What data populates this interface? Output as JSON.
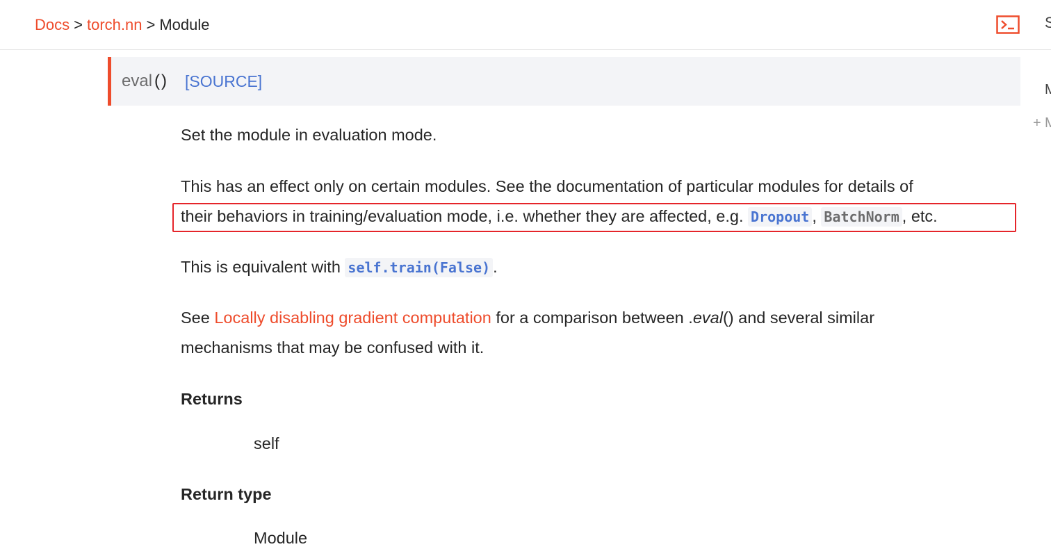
{
  "breadcrumb": {
    "items": [
      {
        "label": "Docs"
      },
      {
        "label": "torch.nn"
      },
      {
        "label": "Module"
      }
    ],
    "separator": ">"
  },
  "header": {
    "right_edge_text": "S"
  },
  "right_sidebar": {
    "line1": "M",
    "line2_prefix": "+",
    "line2": "M"
  },
  "method": {
    "name": "eval",
    "parens": "()",
    "source_label": "[SOURCE]"
  },
  "description": {
    "summary": "Set the module in evaluation mode.",
    "p2_line1": "This has an effect only on certain modules. See the documentation of particular modules for details of",
    "p2_line2_text": "their behaviors in training/evaluation mode, i.e. whether they are affected, e.g.",
    "p2_code1": "Dropout",
    "p2_comma": ",",
    "p2_code2": "BatchNorm",
    "p2_end": ", etc.",
    "p3_prefix": "This is equivalent with",
    "p3_code": "self.train(False)",
    "p3_end": ".",
    "p4_prefix": "See",
    "p4_link": "Locally disabling gradient computation",
    "p4_middle": "for a comparison between .",
    "p4_em": "eval",
    "p4_after_em": "() and several similar",
    "p4_line2": "mechanisms that may be confused with it."
  },
  "fields": {
    "returns_label": "Returns",
    "returns_value": "self",
    "return_type_label": "Return type",
    "return_type_value": "Module"
  },
  "colors": {
    "accent": "#ee4c2c",
    "link_blue": "#4974d1",
    "highlight_box": "#e5252a",
    "sig_bg": "#f3f4f7"
  }
}
